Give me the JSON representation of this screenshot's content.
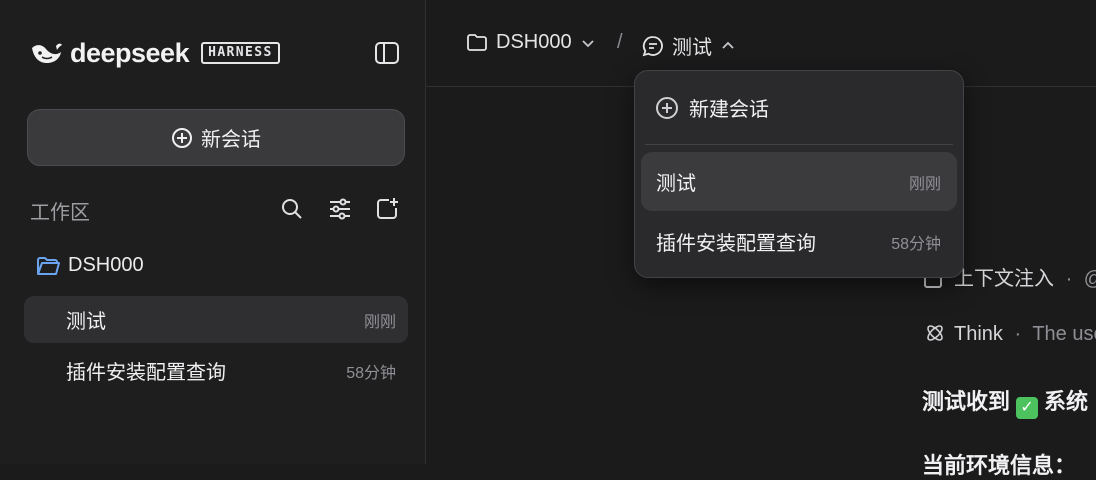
{
  "sidebar": {
    "brand": "deepseek",
    "brand_badge": "HARNESS",
    "new_chat_label": "新会话",
    "workspace_label": "工作区",
    "folder_name": "DSH000",
    "chats": [
      {
        "title": "测试",
        "time": "刚刚",
        "active": true
      },
      {
        "title": "插件安装配置查询",
        "time": "58分钟",
        "active": false
      }
    ]
  },
  "header": {
    "folder": "DSH000",
    "separator": "/",
    "chat": "测试"
  },
  "dropdown": {
    "new_label": "新建会话",
    "items": [
      {
        "title": "测试",
        "time": "刚刚"
      },
      {
        "title": "插件安装配置查询",
        "time": "58分钟"
      }
    ]
  },
  "content": {
    "context_label": "上下文注入",
    "context_sep": "·",
    "context_tail": "@",
    "think_label": "Think",
    "think_sep": "·",
    "think_text": "The use",
    "reply_prefix": "测试收到",
    "reply_tail": "系统",
    "env_heading": "当前环境信息："
  },
  "colors": {
    "background": "#1b1b1c",
    "sidebar": "#1e1e1f",
    "accent_folder": "#6aa3f0",
    "check_green": "#4cc35e"
  }
}
